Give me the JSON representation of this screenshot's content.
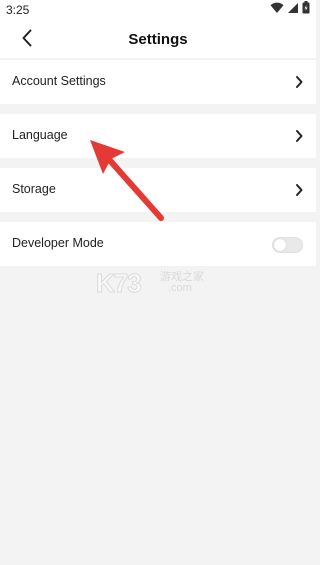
{
  "status_bar": {
    "time": "3:25",
    "icons": [
      "wifi-icon",
      "signal-icon",
      "battery-icon"
    ]
  },
  "header": {
    "title": "Settings",
    "back_icon": "chevron-left-icon"
  },
  "settings": {
    "items": [
      {
        "label": "Account Settings",
        "control": "chevron"
      },
      {
        "label": "Language",
        "control": "chevron"
      },
      {
        "label": "Storage",
        "control": "chevron"
      },
      {
        "label": "Developer Mode",
        "control": "toggle",
        "enabled": false
      }
    ]
  },
  "annotation": {
    "arrow_color": "#e53935"
  },
  "watermark": {
    "brand": "K73",
    "cn_text": "游戏之家",
    "domain": ".com"
  }
}
